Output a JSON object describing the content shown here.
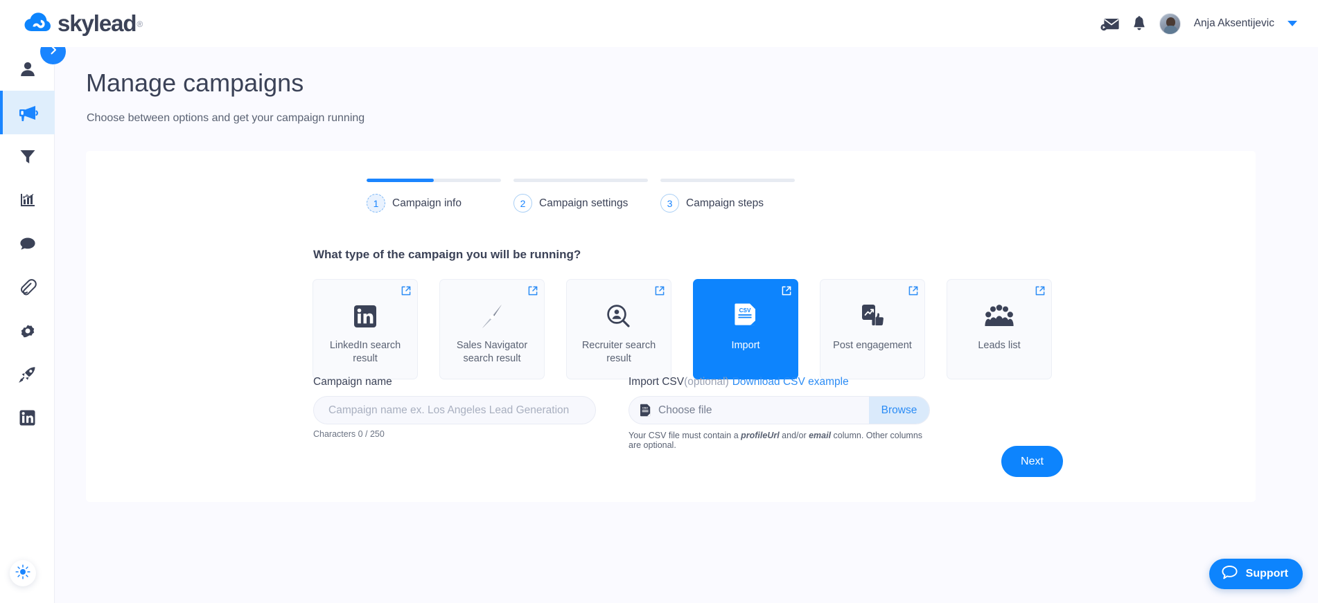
{
  "topbar": {
    "logo_text": "skylead",
    "logo_registered": "®",
    "logo_icon": "skylead-cloud-logo",
    "mail_icon": "mail-icon",
    "bell_icon": "bell-notification-icon",
    "avatar_alt": "user-avatar",
    "username": "Anja Aksentijevic",
    "caret_icon": "chevron-down-icon"
  },
  "sidebar": {
    "items": [
      {
        "icon": "person-icon",
        "name": "sidebar-item-profile",
        "active": false
      },
      {
        "icon": "megaphone-icon",
        "name": "sidebar-item-campaigns",
        "active": true
      },
      {
        "icon": "funnel-icon",
        "name": "sidebar-item-filters",
        "active": false
      },
      {
        "icon": "chart-icon",
        "name": "sidebar-item-analytics",
        "active": false
      },
      {
        "icon": "chat-bubble-icon",
        "name": "sidebar-item-inbox",
        "active": false
      },
      {
        "icon": "paperclip-icon",
        "name": "sidebar-item-attachments",
        "active": false
      },
      {
        "icon": "gear-icon",
        "name": "sidebar-item-settings",
        "active": false
      },
      {
        "icon": "rocket-icon",
        "name": "sidebar-item-boost",
        "active": false
      },
      {
        "icon": "linkedin-icon",
        "name": "sidebar-item-linkedin",
        "active": false
      }
    ],
    "expand_icon": "chevron-right-icon",
    "theme_icon": "sun-brightness-icon"
  },
  "header": {
    "title": "Manage campaigns",
    "subtitle": "Choose between options and get your campaign running"
  },
  "stepper": {
    "steps": [
      {
        "number": "1",
        "label": "Campaign info",
        "progress": 50,
        "state": "current"
      },
      {
        "number": "2",
        "label": "Campaign settings",
        "progress": 0,
        "state": "idle"
      },
      {
        "number": "3",
        "label": "Campaign steps",
        "progress": 0,
        "state": "idle"
      }
    ]
  },
  "main": {
    "question": "What type of the campaign you will be running?",
    "campaign_types": [
      {
        "label": "LinkedIn search result",
        "icon": "linkedin-icon",
        "selected": false
      },
      {
        "label": "Sales Navigator search result",
        "icon": "compass-icon",
        "selected": false
      },
      {
        "label": "Recruiter search result",
        "icon": "person-search-icon",
        "selected": false
      },
      {
        "label": "Import",
        "icon": "csv-file-icon",
        "selected": true
      },
      {
        "label": "Post engagement",
        "icon": "post-thumbsup-icon",
        "selected": false
      },
      {
        "label": "Leads list",
        "icon": "people-group-icon",
        "selected": false
      }
    ],
    "external_link_icon": "external-link-icon",
    "campaign_name": {
      "label": "Campaign name",
      "value": "",
      "placeholder": "Campaign name ex. Los Angeles Lead Generation",
      "char_count": "Characters 0 / 250"
    },
    "import_csv": {
      "label": "Import CSV",
      "optional": "(optional)",
      "download_link": "Download CSV example",
      "file_icon": "csv-file-icon",
      "file_placeholder": "Choose file",
      "browse_label": "Browse",
      "hint_part1": "Your CSV file must contain a ",
      "hint_em1": "profileUrl",
      "hint_part2": " and/or ",
      "hint_em2": "email",
      "hint_part3": " column. Other columns are optional."
    },
    "next_label": "Next"
  },
  "support": {
    "label": "Support",
    "icon": "chat-bubble-outline-icon"
  },
  "colors": {
    "accent_blue": "#0d84fd",
    "link_blue": "#2b8cf5",
    "dark_navy": "#3b4257",
    "page_bg": "#fafaff"
  }
}
